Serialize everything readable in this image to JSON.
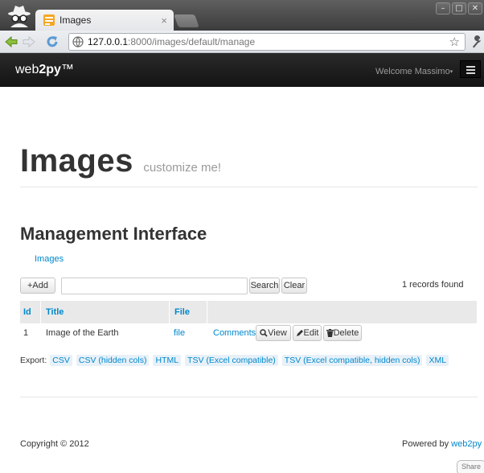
{
  "browser": {
    "tab_title": "Images",
    "tab_close": "×",
    "url_host": "127.0.0.1",
    "url_rest": ":8000/images/default/manage",
    "window_buttons": [
      "–",
      "□",
      "✕"
    ]
  },
  "navbar": {
    "brand_prefix": "web",
    "brand_bold": "2py",
    "brand_suffix": "™",
    "welcome": "Welcome Massimo",
    "caret": "▾"
  },
  "page": {
    "title": "Images",
    "subtitle": "customize me!",
    "heading": "Management Interface",
    "breadcrumb": "Images"
  },
  "grid": {
    "add_label": "+Add",
    "search_value": "",
    "search_button": "Search",
    "clear_button": "Clear",
    "records_found": "1 records found",
    "columns": [
      "Id",
      "Title",
      "File"
    ],
    "row": {
      "id": "1",
      "title": "Image of the Earth",
      "file": "file",
      "comments": "Comments",
      "view": "View",
      "edit": "Edit",
      "delete": "Delete"
    },
    "export_label": "Export:",
    "export_links": [
      "CSV",
      "CSV (hidden cols)",
      "HTML",
      "TSV (Excel compatible)",
      "TSV (Excel compatible, hidden cols)",
      "XML"
    ]
  },
  "footer": {
    "copyright": "Copyright © 2012",
    "powered_by": "Powered by",
    "powered_link": "web2py",
    "share": "Share"
  },
  "colors": {
    "link": "#0088cc",
    "navbar": "#1b1b1b"
  }
}
